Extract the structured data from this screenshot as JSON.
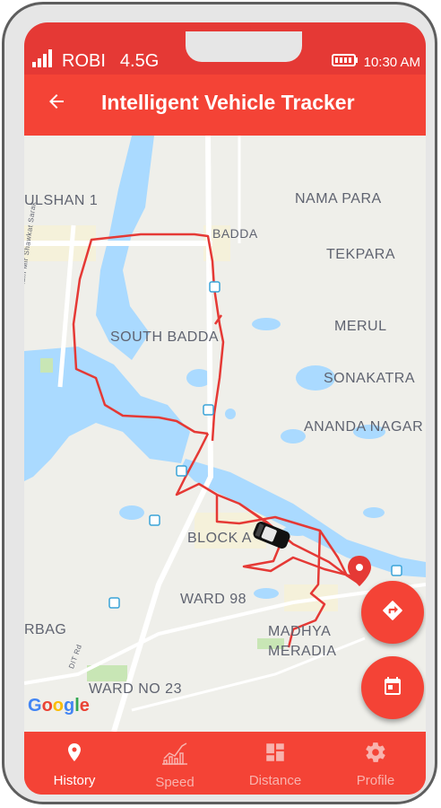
{
  "status_bar": {
    "carrier": "ROBI",
    "network": "4.5G",
    "time": "10:30 AM"
  },
  "app_bar": {
    "title": "Intelligent Vehicle Tracker",
    "back_icon": "arrow-left-icon"
  },
  "map": {
    "labels": {
      "gulshan": "ULSHAN 1",
      "nama_para": "NAMA PARA",
      "badda": "BADDA",
      "tekpara": "TEKPARA",
      "merul": "MERUL",
      "south_badda": "SOUTH BADDA",
      "sonakatra": "SONAKATRA",
      "ananda_nagar": "ANANDA NAGAR",
      "block_a": "BLOCK A",
      "ward_98": "WARD 98",
      "madhya": "MADHYA",
      "meradia": "MERADIA",
      "rbag": "RBAG",
      "ward_no_23": "WARD NO 23",
      "road": "Bir Uttam Mir Shawkat Sarak",
      "road2": "DIT Rd"
    },
    "google_logo": "Google",
    "route_color": "#e53935"
  },
  "fabs": {
    "directions_icon": "directions-icon",
    "calendar_icon": "calendar-icon"
  },
  "bottom_nav": {
    "items": [
      {
        "label": "History",
        "icon": "location-pin-icon",
        "active": true
      },
      {
        "label": "Speed",
        "icon": "chart-icon",
        "active": false
      },
      {
        "label": "Distance",
        "icon": "dashboard-icon",
        "active": false
      },
      {
        "label": "Profile",
        "icon": "gear-icon",
        "active": false
      }
    ]
  },
  "colors": {
    "primary": "#f44336",
    "water": "#aadaff",
    "inactive_nav": "#f8b3ae"
  }
}
